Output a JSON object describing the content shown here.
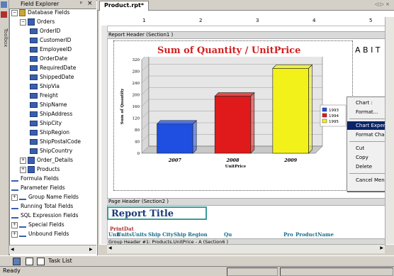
{
  "toolbox": {
    "label": "Toolbox"
  },
  "field_explorer": {
    "title": "Field Explorer",
    "pin": "ᵖ",
    "close": "×",
    "items": [
      {
        "label": "Database Fields",
        "level": 1,
        "type": "db",
        "toggle": "−"
      },
      {
        "label": "Orders",
        "level": 2,
        "type": "tbl",
        "toggle": "−"
      },
      {
        "label": "OrderID",
        "level": 3,
        "type": "field"
      },
      {
        "label": "CustomerID",
        "level": 3,
        "type": "field"
      },
      {
        "label": "EmployeeID",
        "level": 3,
        "type": "field"
      },
      {
        "label": "OrderDate",
        "level": 3,
        "type": "field"
      },
      {
        "label": "RequiredDate",
        "level": 3,
        "type": "field"
      },
      {
        "label": "ShippedDate",
        "level": 3,
        "type": "field"
      },
      {
        "label": "ShipVia",
        "level": 3,
        "type": "field"
      },
      {
        "label": "Freight",
        "level": 3,
        "type": "field"
      },
      {
        "label": "ShipName",
        "level": 3,
        "type": "field"
      },
      {
        "label": "ShipAddress",
        "level": 3,
        "type": "field"
      },
      {
        "label": "ShipCity",
        "level": 3,
        "type": "field"
      },
      {
        "label": "ShipRegion",
        "level": 3,
        "type": "field"
      },
      {
        "label": "ShipPostalCode",
        "level": 3,
        "type": "field"
      },
      {
        "label": "ShipCountry",
        "level": 3,
        "type": "field"
      },
      {
        "label": "Order_Details",
        "level": 2,
        "type": "tbl",
        "toggle": "+"
      },
      {
        "label": "Products",
        "level": 2,
        "type": "tbl",
        "toggle": "+"
      },
      {
        "label": "Formula Fields",
        "level": 1,
        "type": "fx"
      },
      {
        "label": "Parameter Fields",
        "level": 1,
        "type": "fx"
      },
      {
        "label": "Group Name Fields",
        "level": 1,
        "type": "fx",
        "toggle": "+"
      },
      {
        "label": "Running Total Fields",
        "level": 1,
        "type": "fx"
      },
      {
        "label": "SQL Expression Fields",
        "level": 1,
        "type": "fx"
      },
      {
        "label": "Special Fields",
        "level": 1,
        "type": "fx",
        "toggle": "+"
      },
      {
        "label": "Unbound Fields",
        "level": 1,
        "type": "fx",
        "toggle": "+"
      }
    ]
  },
  "document": {
    "tab": "Product.rpt*",
    "nav_arrows": "◁ ▷ ×",
    "ruler_marks": [
      "1",
      "2",
      "3",
      "4",
      "5"
    ]
  },
  "sections": {
    "report_header": "Report Header (Section1 )",
    "page_header": "Page Header (Section2 )",
    "group_header": "Group Header #1: Products.UnitPrice - A (Section6 )"
  },
  "chart_data": {
    "type": "bar",
    "title": "Sum of Quantity / UnitPrice",
    "xlabel": "UnitPrice",
    "ylabel": "Sum of Quantity",
    "categories": [
      "2007",
      "2008",
      "2009"
    ],
    "values": [
      100,
      195,
      290
    ],
    "ylim": [
      0,
      320
    ],
    "yticks": [
      0,
      40,
      80,
      120,
      160,
      200,
      240,
      280,
      320
    ],
    "colors": [
      "#1f4fe0",
      "#e01a1a",
      "#f2f21a"
    ],
    "legend": [
      "1993",
      "1994",
      "1995"
    ],
    "legend_position": "right",
    "grid": true
  },
  "abit_text": "A B I T",
  "context_menu": {
    "items": [
      {
        "label": "Chart :",
        "separator_after": false
      },
      {
        "label": "Format...",
        "separator_after": true
      },
      {
        "label": "Chart Expert...",
        "highlight": true
      },
      {
        "label": "Format Chart",
        "separator_after": true
      },
      {
        "label": "Cut"
      },
      {
        "label": "Copy"
      },
      {
        "label": "Delete",
        "separator_after": true
      },
      {
        "label": "Cancel Menu"
      }
    ]
  },
  "report": {
    "title": "Report Title",
    "print_date": "PrintDat",
    "fields": [
      "Unit",
      "Units",
      "Units",
      "Ship City",
      "Ship Region",
      "Qu",
      "Pro",
      "ProductName"
    ]
  },
  "bottom": {
    "task_list": "Task List",
    "status": "Ready"
  }
}
